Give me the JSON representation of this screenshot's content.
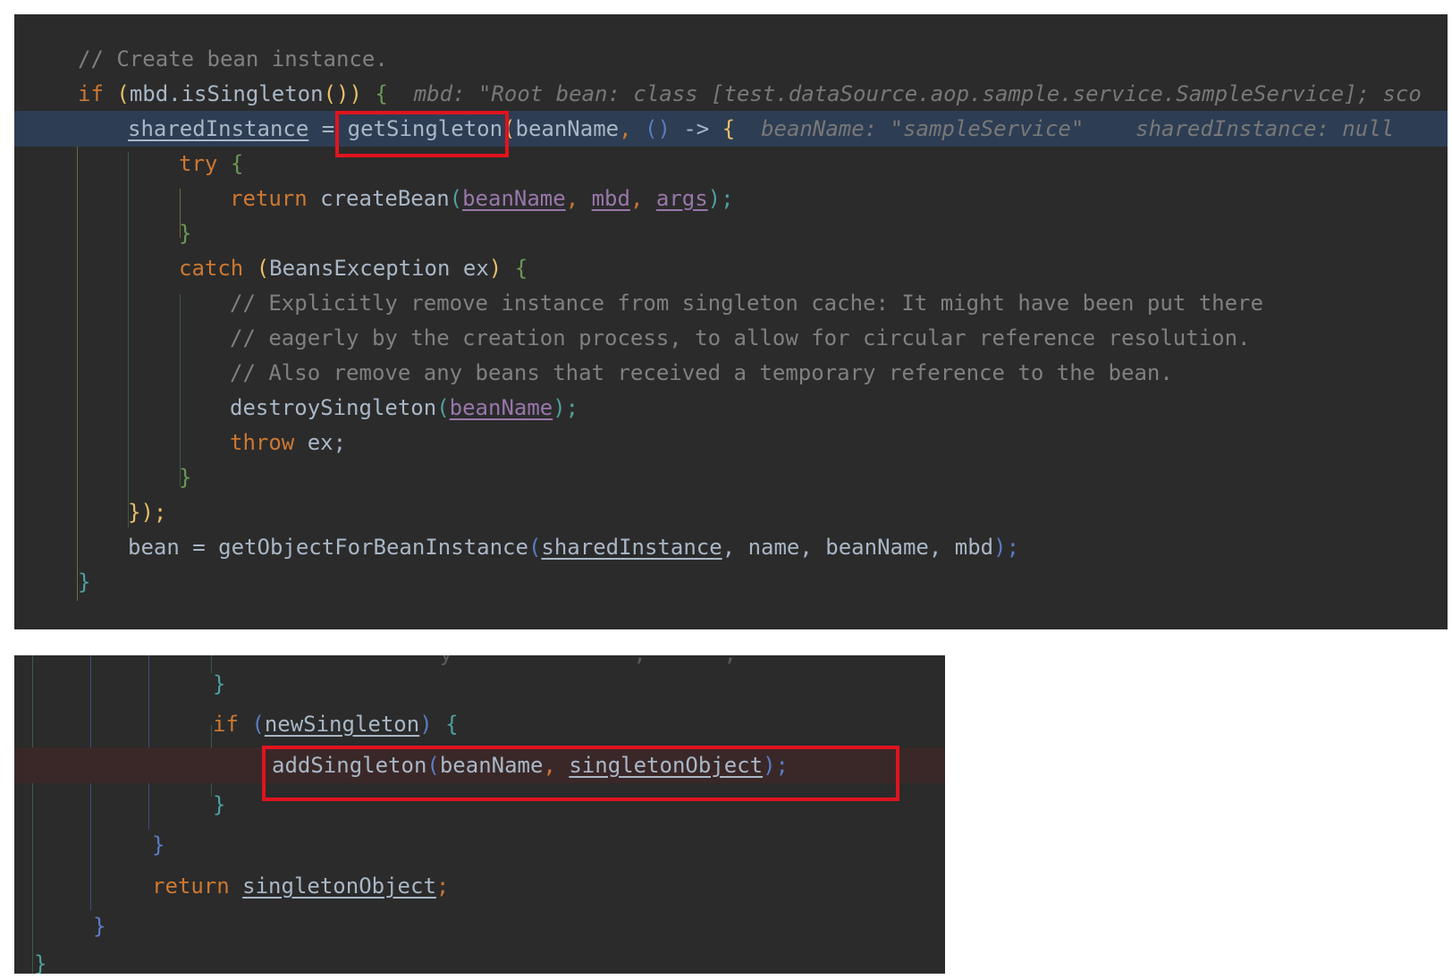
{
  "top": {
    "comment_create": "// Create bean instance.",
    "if_kw": "if",
    "if_open": "(",
    "if_cond": "mbd.isSingleton",
    "if_call": "()",
    "if_close": ")",
    "if_brace": "{",
    "hint_mbd": "mbd: \"Root bean: class [test.dataSource.aop.sample.service.SampleService]; sco",
    "shared_instance": "sharedInstance",
    "assign": "=",
    "get_singleton": "getSingleton",
    "gs_paren": "(",
    "bean_name": "beanName",
    "comma": ",",
    "lambda_parens": "()",
    "arrow": "->",
    "lambda_brace": "{",
    "hint_bean_name": "beanName: \"sampleService\"",
    "hint_shared": "sharedInstance: null",
    "try_kw": "try",
    "try_brace": "{",
    "return_kw": "return",
    "create_bean": "createBean",
    "cb_open": "(",
    "arg_bean_name": "beanName",
    "arg_mbd": "mbd",
    "arg_args": "args",
    "cb_close": ");",
    "try_close": "}",
    "catch_kw": "catch",
    "catch_open": "(",
    "catch_type": "BeansException ex",
    "catch_close": ")",
    "catch_brace": "{",
    "comment_1": "// Explicitly remove instance from singleton cache: It might have been put there",
    "comment_2": "// eagerly by the creation process, to allow for circular reference resolution.",
    "comment_3": "// Also remove any beans that received a temporary reference to the bean.",
    "destroy_singleton": "destroySingleton",
    "ds_open": "(",
    "ds_arg": "beanName",
    "ds_close": ");",
    "throw_kw": "throw",
    "throw_rest": "ex;",
    "catch_end": "}",
    "lambda_end_brace": "}",
    "lambda_end_paren": ");",
    "bean_assign": "bean = getObjectForBeanInstance",
    "gofbi_open": "(",
    "gofbi_shared": "sharedInstance",
    "gofbi_rest": ", name, beanName, mbd",
    "gofbi_close": ");",
    "if_end": "}"
  },
  "bottom": {
    "cut_text": "                 y              ,      ;",
    "brace_1": "}",
    "if_kw": "if",
    "if_open": "(",
    "new_singleton": "newSingleton",
    "if_close": ")",
    "if_brace": "{",
    "add_singleton": "addSingleton",
    "as_open": "(",
    "as_bean_name": "beanName",
    "as_comma": ",",
    "as_singleton_object": "singletonObject",
    "as_close": ");",
    "brace_2": "}",
    "brace_3": "}",
    "return_kw": "return",
    "return_value": "singletonObject",
    "return_semi": ";",
    "brace_4": "}",
    "brace_5": "}"
  },
  "colors": {
    "editor_bg": "#2b2b2b",
    "debug_line_bg": "#2d3d53",
    "breakpoint_line_bg": "#3a2828",
    "keyword": "#cc7832",
    "comment": "#808080",
    "field": "#9876aa",
    "default_text": "#a9b7c6",
    "highlight_box": "#e0141e"
  }
}
